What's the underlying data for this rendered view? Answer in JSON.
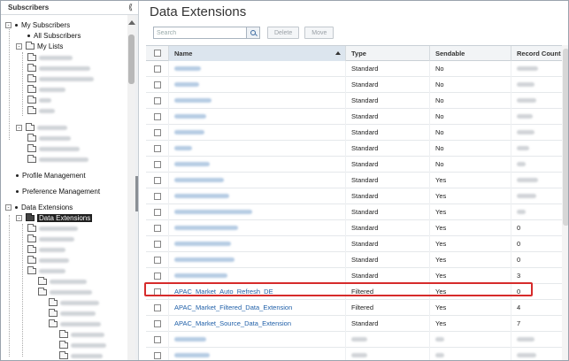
{
  "left_panel": {
    "title": "Subscribers",
    "tree": {
      "my_subscribers": "My Subscribers",
      "all_subscribers": "All Subscribers",
      "my_lists": "My Lists",
      "profile_management": "Profile Management",
      "preference_management": "Preference Management",
      "data_extensions": "Data Extensions",
      "data_extensions_folder": "Data Extensions",
      "expander_minus": "-"
    }
  },
  "main": {
    "title": "Data Extensions",
    "search": {
      "placeholder": "Search"
    },
    "toolbar": {
      "delete_label": "Delete",
      "move_label": "Move"
    },
    "columns": {
      "name": "Name",
      "type": "Type",
      "sendable": "Sendable",
      "record_count": "Record Count"
    },
    "rows": [
      {
        "name": "",
        "type": "Standard",
        "sendable": "No",
        "count": ""
      },
      {
        "name": "",
        "type": "Standard",
        "sendable": "No",
        "count": ""
      },
      {
        "name": "",
        "type": "Standard",
        "sendable": "No",
        "count": ""
      },
      {
        "name": "",
        "type": "Standard",
        "sendable": "No",
        "count": ""
      },
      {
        "name": "",
        "type": "Standard",
        "sendable": "No",
        "count": ""
      },
      {
        "name": "",
        "type": "Standard",
        "sendable": "No",
        "count": ""
      },
      {
        "name": "",
        "type": "Standard",
        "sendable": "No",
        "count": ""
      },
      {
        "name": "",
        "type": "Standard",
        "sendable": "Yes",
        "count": ""
      },
      {
        "name": "",
        "type": "Standard",
        "sendable": "Yes",
        "count": ""
      },
      {
        "name": "",
        "type": "Standard",
        "sendable": "Yes",
        "count": ""
      },
      {
        "name": "",
        "type": "Standard",
        "sendable": "Yes",
        "count": "0"
      },
      {
        "name": "",
        "type": "Standard",
        "sendable": "Yes",
        "count": "0"
      },
      {
        "name": "",
        "type": "Standard",
        "sendable": "Yes",
        "count": "0"
      },
      {
        "name": "",
        "type": "Standard",
        "sendable": "Yes",
        "count": "3"
      },
      {
        "name": "APAC_Market_Auto_Refresh_DE",
        "type": "Filtered",
        "sendable": "Yes",
        "count": "0"
      },
      {
        "name": "APAC_Market_Filtered_Data_Extension",
        "type": "Filtered",
        "sendable": "Yes",
        "count": "4"
      },
      {
        "name": "APAC_Market_Source_Data_Extension",
        "type": "Standard",
        "sendable": "Yes",
        "count": "7"
      },
      {
        "name": "",
        "type": "",
        "sendable": "",
        "count": ""
      },
      {
        "name": "",
        "type": "",
        "sendable": "",
        "count": ""
      }
    ],
    "highlight_color": "#d62b2b",
    "link_color": "#1f5fa8"
  }
}
